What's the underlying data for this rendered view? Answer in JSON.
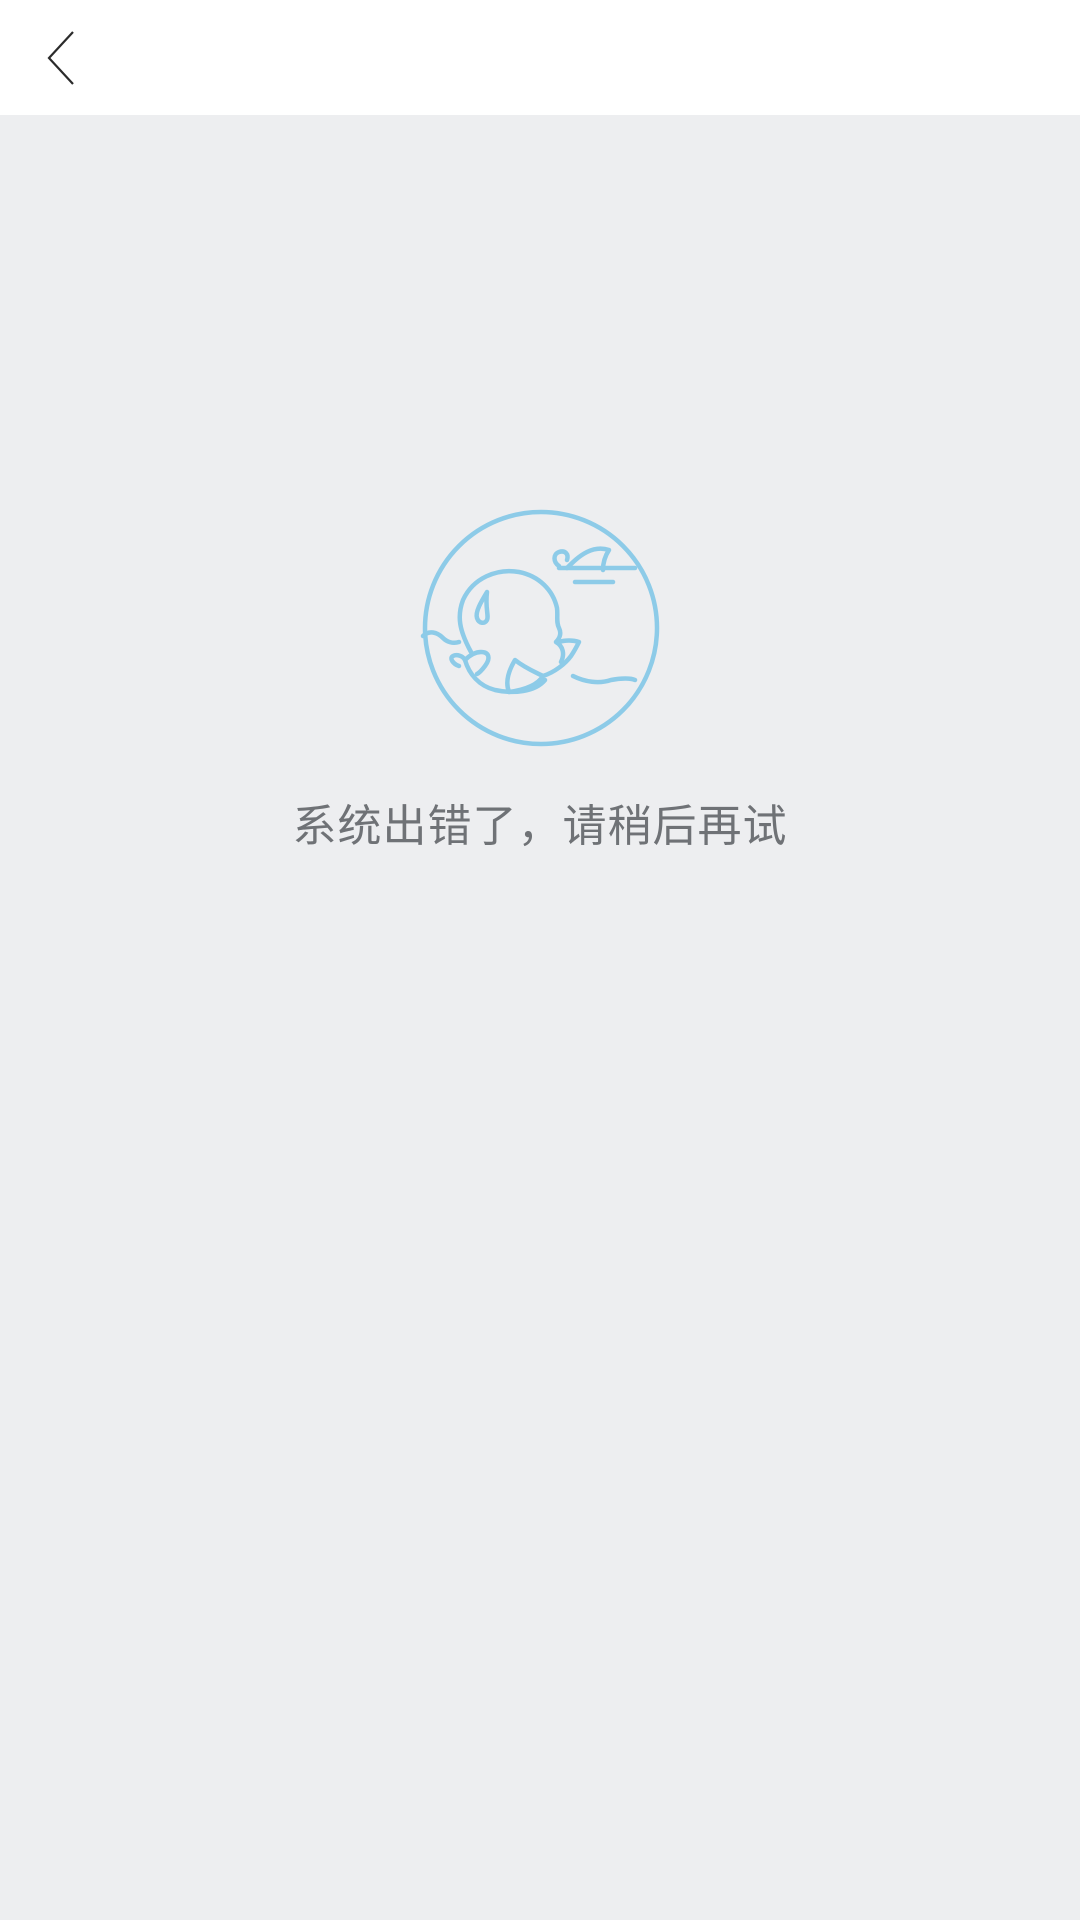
{
  "header": {
    "back_icon": "chevron-left-icon"
  },
  "error": {
    "illustration_icon": "baby-face-icon",
    "message": "系统出错了，请稍后再试",
    "accent_color": "#8dcbe8",
    "text_color": "#6f7276"
  },
  "colors": {
    "background": "#edeef0",
    "header_background": "#ffffff"
  }
}
